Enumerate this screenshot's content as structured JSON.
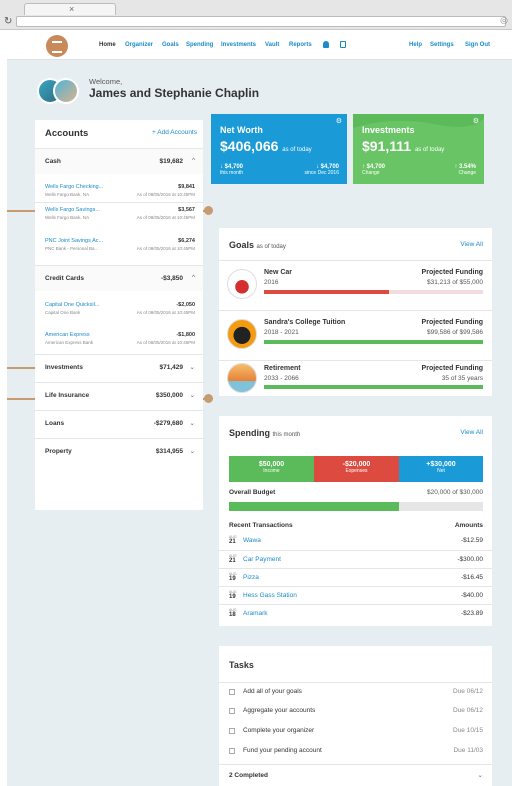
{
  "browser": {
    "tab_close": "×",
    "reload_icon": "↻",
    "url_icon": "◎"
  },
  "nav": {
    "items": [
      "Home",
      "Organizer",
      "Goals",
      "Spending",
      "Investments",
      "Vault",
      "Reports"
    ],
    "right": [
      "Help",
      "Settings",
      "Sign Out"
    ]
  },
  "welcome": {
    "label": "Welcome,",
    "name": "James and Stephanie Chaplin"
  },
  "accounts": {
    "title": "Accounts",
    "add_label": "+ Add Accounts",
    "cash": {
      "label": "Cash",
      "amount": "$19,682",
      "chev": "^"
    },
    "cash_items": [
      {
        "name": "Wells Fargo Checking...",
        "bank": "Wells Fargo Bank, NA",
        "amount": "$9,841",
        "date": ""
      },
      {
        "name": "Wells Fargo Savings...",
        "bank": "Wells Fargo Bank, NA",
        "amount": "$3,567",
        "date": "As of 08/05/2016 at 10:45PM"
      },
      {
        "name": "PNC Joint Savings Ac...",
        "bank": "PNC Bank - Personal Ba...",
        "amount": "$6,274",
        "date": "As of 08/05/2016 at 10:45PM"
      }
    ],
    "first_date": "As of 08/05/2016 at 10:45PM",
    "credit": {
      "label": "Credit Cards",
      "amount": "-$3,850",
      "chev": "^"
    },
    "credit_items": [
      {
        "name": "Capital One Quicksil...",
        "bank": "Capital One Bank",
        "amount": "-$2,050",
        "date": "As of 08/05/2016 at 10:45PM"
      },
      {
        "name": "American Express",
        "bank": "American Express Bank",
        "amount": "-$1,800",
        "date": "As of 08/05/2016 at 10:45PM"
      }
    ],
    "others": [
      {
        "label": "Investments",
        "amount": "$71,429",
        "chev": "⌄"
      },
      {
        "label": "Life Insurance",
        "amount": "$350,000",
        "chev": "⌄"
      },
      {
        "label": "Loans",
        "amount": "-$279,680",
        "chev": "⌄"
      },
      {
        "label": "Property",
        "amount": "$314,955",
        "chev": "⌄"
      }
    ]
  },
  "net_worth": {
    "title": "Net Worth",
    "value": "$406,066",
    "as_of": "as of today",
    "gear": "⚙",
    "left_amt": "↓ $4,700",
    "left_lbl": "this month",
    "right_amt": "↓ $4,700",
    "right_lbl": "since Dec 2016",
    "color": "#1a9ad6"
  },
  "investments": {
    "title": "Investments",
    "value": "$91,111",
    "as_of": "as of today",
    "gear": "⚙",
    "left_amt": "↑ $4,700",
    "left_lbl": "Change",
    "right_amt": "↑ 3.54%",
    "right_lbl": "Change",
    "color": "#5bba59"
  },
  "goals": {
    "title": "Goals",
    "subtitle": "as of today",
    "view_all": "View All",
    "items": [
      {
        "name": "New Car",
        "years": "2016",
        "proj_label": "Projected Funding",
        "proj_value": "$31,213 of $55,000",
        "progress": 0.57,
        "color": "#dd4b40"
      },
      {
        "name": "Sandra's College Tuition",
        "years": "2018 - 2021",
        "proj_label": "Projected Funding",
        "proj_value": "$99,586 of $99,586",
        "progress": 1.0,
        "color": "#5bba59"
      },
      {
        "name": "Retirement",
        "years": "2033 - 2066",
        "proj_label": "Projected Funding",
        "proj_value": "35 of 35 years",
        "progress": 1.0,
        "color": "#5bba59"
      }
    ]
  },
  "spending": {
    "title": "Spending",
    "subtitle": "this month",
    "view_all": "View All",
    "income": {
      "value": "$50,000",
      "label": "Income",
      "color": "#5bba59"
    },
    "expenses": {
      "value": "-$20,000",
      "label": "Expenses",
      "color": "#dd4b40"
    },
    "net": {
      "value": "+$30,000",
      "label": "Net",
      "color": "#1a9ad6"
    },
    "budget_label": "Overall Budget",
    "budget_value": "$20,000 of $30,000",
    "budget_progress": 0.67,
    "recent_label": "Recent Transactions",
    "amounts_label": "Amounts",
    "transactions": [
      {
        "mon": "AUG",
        "day": "21",
        "name": "Wawa",
        "amount": "-$12.59"
      },
      {
        "mon": "AUG",
        "day": "21",
        "name": "Car Payment",
        "amount": "-$300.00"
      },
      {
        "mon": "AUG",
        "day": "19",
        "name": "Pizza",
        "amount": "-$16.45"
      },
      {
        "mon": "AUG",
        "day": "19",
        "name": "Hess Gass Station",
        "amount": "-$40.00"
      },
      {
        "mon": "AUG",
        "day": "18",
        "name": "Aramark",
        "amount": "-$23.89"
      }
    ]
  },
  "tasks": {
    "title": "Tasks",
    "items": [
      {
        "name": "Add all of your goals",
        "due": "Due 06/12"
      },
      {
        "name": "Aggregate your accounts",
        "due": "Due 06/12"
      },
      {
        "name": "Complete your organizer",
        "due": "Due 10/15"
      },
      {
        "name": "Fund your pending account",
        "due": "Due 11/03"
      }
    ],
    "completed": "2 Completed",
    "chev": "⌄"
  }
}
